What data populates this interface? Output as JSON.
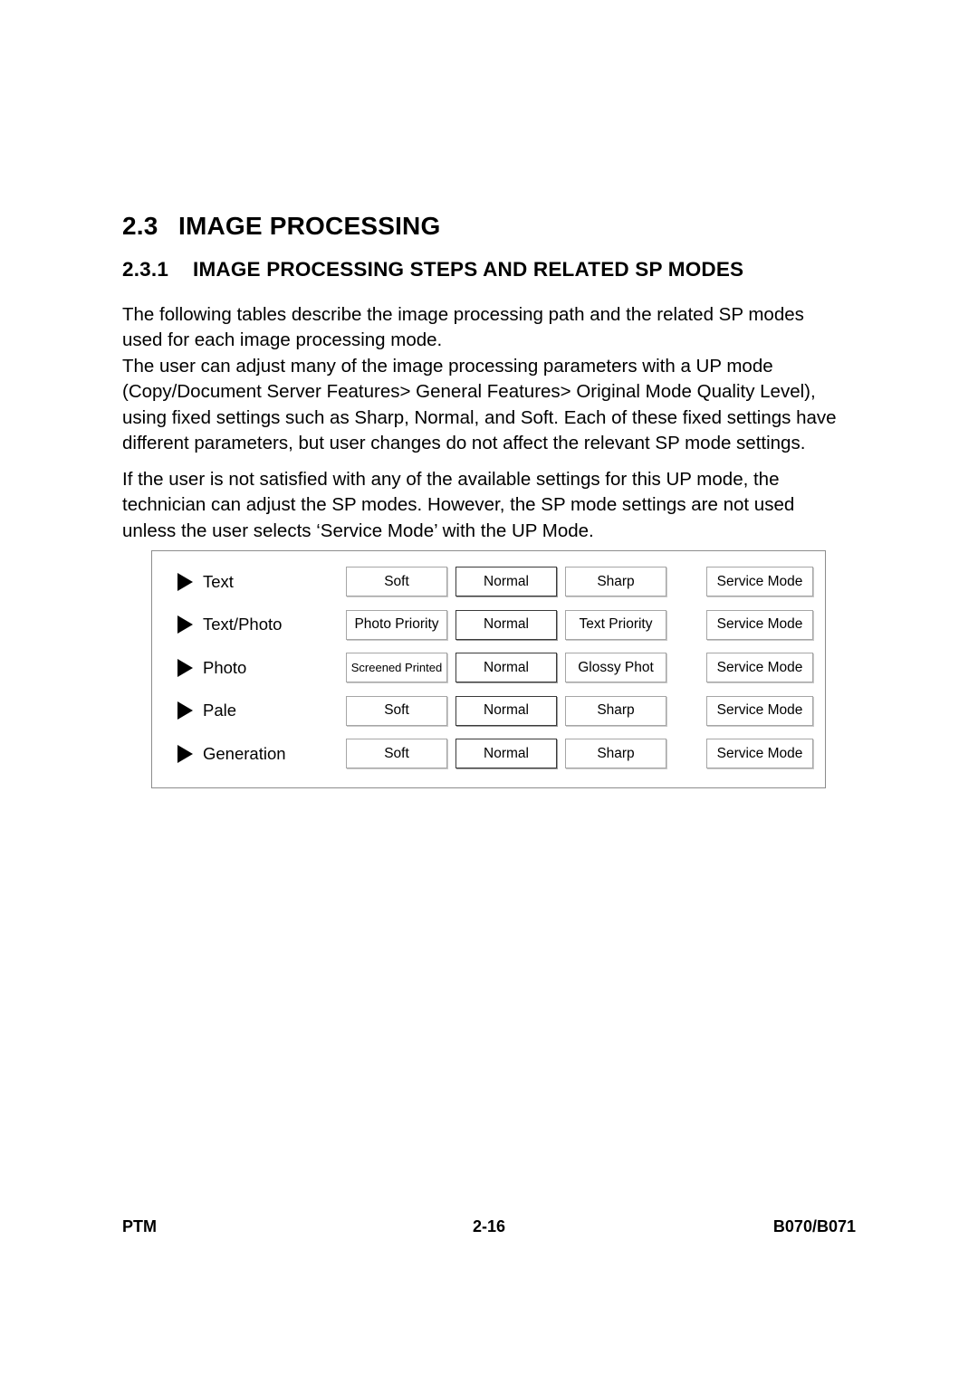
{
  "document": {
    "headings": {
      "section_number": "2.3",
      "section_title": "IMAGE PROCESSING",
      "subsection_number": "2.3.1",
      "subsection_title": "IMAGE PROCESSING STEPS AND RELATED SP MODES"
    },
    "paragraphs": [
      "The following tables describe the image processing path and the related SP modes used for each image processing mode.",
      "The user can adjust many of the image processing parameters with a UP mode (Copy/Document Server Features> General Features> Original Mode Quality Level), using fixed settings such as Sharp, Normal, and Soft. Each of these fixed settings have different parameters, but user changes do not affect the relevant SP mode settings.",
      "If the user is not satisfied with any of the available settings for this UP mode, the technician can adjust the SP modes. However, the SP mode settings are not used unless the user selects ‘Service Mode’ with the UP Mode."
    ],
    "footer": {
      "left": "PTM",
      "center": "2-16",
      "right": "B070/B071"
    }
  },
  "diagram": {
    "bullet_icon": "triangle-right-icon",
    "rows": [
      {
        "label": "Text",
        "options": [
          {
            "label": "Soft",
            "selected": false,
            "small": false
          },
          {
            "label": "Normal",
            "selected": true,
            "small": false
          },
          {
            "label": "Sharp",
            "selected": false,
            "small": false
          },
          {
            "label": "Service Mode",
            "selected": false,
            "small": false
          }
        ]
      },
      {
        "label": "Text/Photo",
        "options": [
          {
            "label": "Photo Priority",
            "selected": false,
            "small": false
          },
          {
            "label": "Normal",
            "selected": true,
            "small": false
          },
          {
            "label": "Text Priority",
            "selected": false,
            "small": false
          },
          {
            "label": "Service Mode",
            "selected": false,
            "small": false
          }
        ]
      },
      {
        "label": "Photo",
        "options": [
          {
            "label": "Screened Printed",
            "selected": false,
            "small": true
          },
          {
            "label": "Normal",
            "selected": true,
            "small": false
          },
          {
            "label": "Glossy Phot",
            "selected": false,
            "small": false
          },
          {
            "label": "Service Mode",
            "selected": false,
            "small": false
          }
        ]
      },
      {
        "label": "Pale",
        "options": [
          {
            "label": "Soft",
            "selected": false,
            "small": false
          },
          {
            "label": "Normal",
            "selected": true,
            "small": false
          },
          {
            "label": "Sharp",
            "selected": false,
            "small": false
          },
          {
            "label": "Service Mode",
            "selected": false,
            "small": false
          }
        ]
      },
      {
        "label": "Generation",
        "options": [
          {
            "label": "Soft",
            "selected": false,
            "small": false
          },
          {
            "label": "Normal",
            "selected": true,
            "small": false
          },
          {
            "label": "Sharp",
            "selected": false,
            "small": false
          },
          {
            "label": "Service Mode",
            "selected": false,
            "small": false
          }
        ]
      }
    ]
  },
  "colors": {
    "text": "#000000",
    "box_border": "#8c8c8c",
    "button_border": "#a6a6a6",
    "button_border_selected": "#3a3a3a",
    "page_background": "#ffffff"
  }
}
